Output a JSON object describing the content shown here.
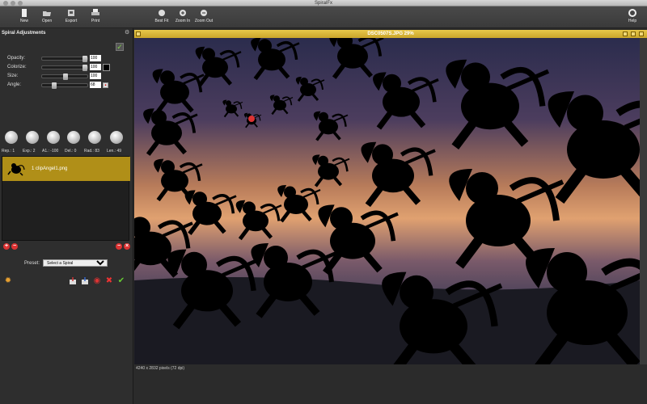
{
  "window": {
    "title": "SpiralFx"
  },
  "toolbar": {
    "new": "New",
    "open": "Open",
    "export": "Export",
    "print": "Print",
    "best_fit": "Best Fit",
    "zoom_in": "Zoom In",
    "zoom_out": "Zoom Out",
    "help": "Help"
  },
  "panel": {
    "title": "Spiral Adjustments",
    "opacity_label": "Opacity:",
    "opacity_value": "100",
    "colorize_label": "Colorize:",
    "colorize_value": "100",
    "size_label": "Size:",
    "size_value": "100",
    "angle_label": "Angle:",
    "angle_value": "68",
    "knobs": [
      {
        "label": "Rep.: 1"
      },
      {
        "label": "Exp.: 2"
      },
      {
        "label": "A1.: -100"
      },
      {
        "label": "Del.: 0"
      },
      {
        "label": "Rad.: 83"
      },
      {
        "label": "Len.: 49"
      }
    ],
    "layer_item": "1 clipAngel1.png",
    "preset_label": "Preset:",
    "preset_value": "Select a Spiral"
  },
  "document": {
    "title": "DSC0507S.JPG 29%",
    "status": "4240 x 2832 pixels (72 dpi)"
  },
  "colors": {
    "accent": "#c9a52a",
    "item": "#b08f18"
  }
}
